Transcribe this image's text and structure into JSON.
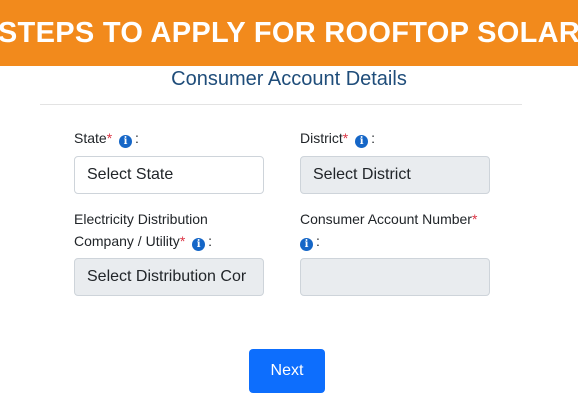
{
  "banner": {
    "title": "STEPS TO APPLY FOR ROOFTOP SOLAR",
    "color": "#f28a1c"
  },
  "form": {
    "section_title": "Consumer Account Details",
    "required_mark": "*",
    "colon": ":",
    "info_glyph": "i",
    "fields": {
      "state": {
        "label": "State",
        "value": "Select State"
      },
      "district": {
        "label": "District",
        "value": "Select District"
      },
      "discom": {
        "label_line1": "Electricity Distribution",
        "label_line2": "Company / Utility",
        "value": "Select Distribution Cor"
      },
      "consumer_account": {
        "label": "Consumer Account Number",
        "value": ""
      }
    },
    "next_label": "Next"
  }
}
